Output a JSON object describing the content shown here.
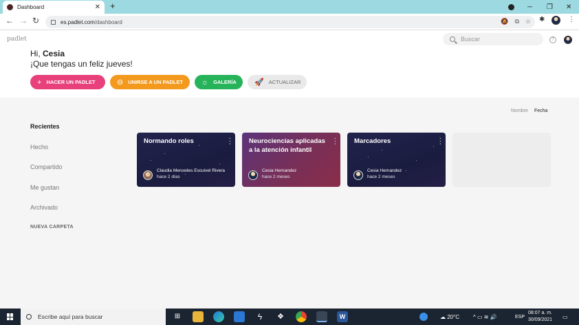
{
  "browser": {
    "tab_title": "Dashboard",
    "tab_close": "✕",
    "new_tab": "+",
    "url_host": "es.padlet.com",
    "url_path": "/dashboard",
    "window_controls": [
      "─",
      "❐",
      "✕"
    ]
  },
  "padlet": {
    "brand": "padlet",
    "search_placeholder": "Buscar",
    "help": "?",
    "greeting_prefix": "Hi,",
    "user_name": "Cesia",
    "subgreeting": "¡Que tengas un feliz jueves!",
    "actions": [
      {
        "label": "HACER UN PADLET",
        "icon": "+"
      },
      {
        "label": "UNIRSE A UN PADLET",
        "icon": "⊖"
      },
      {
        "label": "GALERÍA",
        "icon": "☼"
      },
      {
        "label": "ACTUALIZAR",
        "icon": "🚀"
      }
    ],
    "sort": {
      "name": "Nombre",
      "date": "Fecha",
      "active": "date"
    },
    "sidebar": {
      "heading": "Recientes",
      "items": [
        "Hecho",
        "Compartido",
        "Me gustan",
        "Archivado"
      ],
      "new_folder": "NUEVA CARPETA"
    },
    "cards": [
      {
        "title": "Normando roles",
        "author": "Claudia Mercedes Escuivel Rivera",
        "date": "hace 2 días",
        "theme": "space"
      },
      {
        "title": "Neurociencias aplicadas a la atención infantil",
        "author": "Cesia Hernandez",
        "date": "hace 2 meses",
        "theme": "purple"
      },
      {
        "title": "Marcadores",
        "author": "Cesia Hernandez",
        "date": "hace 2 meses",
        "theme": "space"
      }
    ]
  },
  "taskbar": {
    "search_placeholder": "Escribe aquí para buscar",
    "weather": "20°C",
    "language": "ESP",
    "time": "08:07 a. m.",
    "date": "30/09/2021"
  },
  "colors": {
    "tab_strip": "#9dd9e0",
    "pink": "#e8407a",
    "orange": "#f39a1e",
    "green": "#27b35a"
  }
}
